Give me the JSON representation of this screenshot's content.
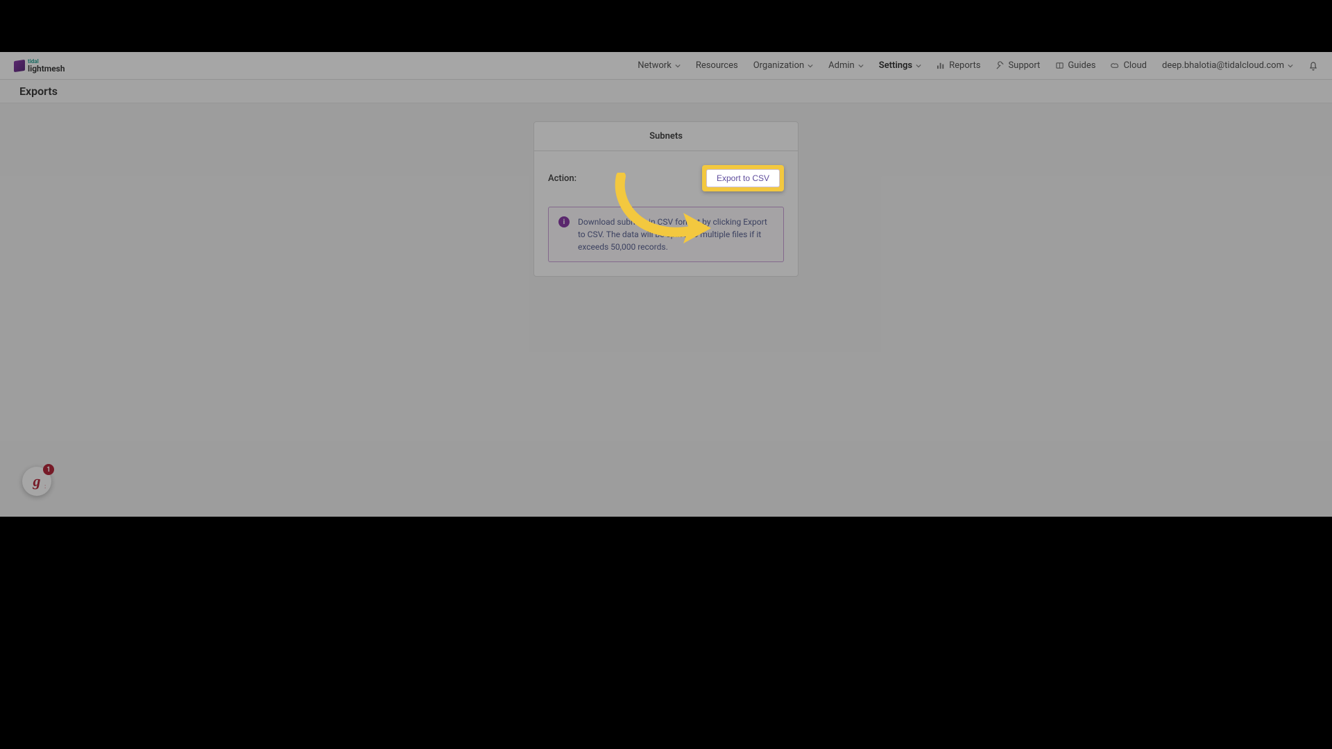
{
  "logo": {
    "tidal": "tidal",
    "lightmesh": "lightmesh"
  },
  "nav": {
    "network": "Network",
    "resources": "Resources",
    "organization": "Organization",
    "admin": "Admin",
    "settings": "Settings",
    "reports": "Reports",
    "support": "Support",
    "guides": "Guides",
    "cloud": "Cloud",
    "user_email": "deep.bhalotia@tidalcloud.com"
  },
  "page": {
    "title": "Exports"
  },
  "card": {
    "header": "Subnets",
    "action_label": "Action:",
    "export_button": "Export to CSV",
    "info_text": "Download subnets in CSV format by clicking Export to CSV. The data will be split into multiple files if it exceeds 50,000 records."
  },
  "widget": {
    "letter": "g",
    "badge": "1"
  }
}
